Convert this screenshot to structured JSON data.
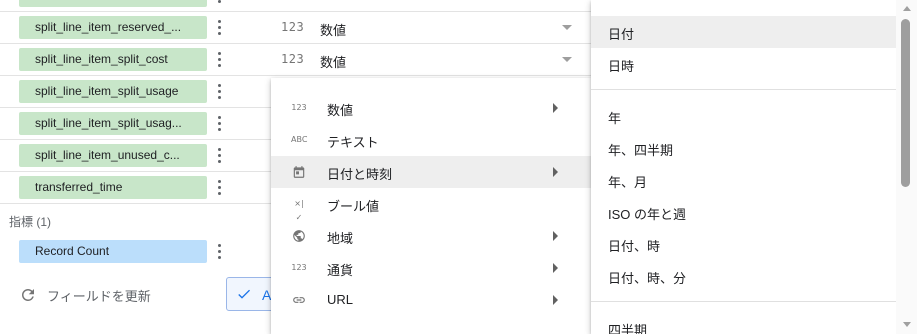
{
  "fields": [
    {
      "name": "split_line_item_reserved_...",
      "type_icon": "123",
      "type_label": "数値"
    },
    {
      "name": "split_line_item_split_cost",
      "type_icon": "123",
      "type_label": "数値"
    },
    {
      "name": "split_line_item_split_usage"
    },
    {
      "name": "split_line_item_split_usag..."
    },
    {
      "name": "split_line_item_unused_c..."
    },
    {
      "name": "transferred_time"
    }
  ],
  "metrics_section": {
    "label": "指標 (1)"
  },
  "metrics": [
    {
      "name": "Record Count"
    }
  ],
  "refresh": {
    "label": "フィールドを更新",
    "icon": "refresh-icon"
  },
  "add_button": {
    "label": "A",
    "icon": "check-icon"
  },
  "type_menu": {
    "items": [
      {
        "icon": "123",
        "label": "数値",
        "has_submenu": true
      },
      {
        "icon": "ABC",
        "label": "テキスト",
        "has_submenu": false
      },
      {
        "icon": "calendar-icon",
        "label": "日付と時刻",
        "has_submenu": true,
        "active": true
      },
      {
        "icon": "×|✓",
        "label": "ブール値",
        "has_submenu": false
      },
      {
        "icon": "globe-icon",
        "label": "地域",
        "has_submenu": true
      },
      {
        "icon": "123",
        "label": "通貨",
        "has_submenu": true
      },
      {
        "icon": "link-icon",
        "label": "URL",
        "has_submenu": true
      }
    ]
  },
  "date_submenu": {
    "group1": [
      {
        "label": "日付",
        "active": true
      },
      {
        "label": "日時"
      }
    ],
    "group2": [
      {
        "label": "年"
      },
      {
        "label": "年、四半期"
      },
      {
        "label": "年、月"
      },
      {
        "label": "ISO の年と週"
      },
      {
        "label": "日付、時"
      },
      {
        "label": "日付、時、分"
      }
    ],
    "group3": [
      {
        "label": "四半期"
      }
    ]
  },
  "colors": {
    "dimension_chip": "#c8e6c9",
    "metric_chip": "#bbdefb",
    "accent": "#1a73e8",
    "menu_hover": "#eeeeee"
  }
}
